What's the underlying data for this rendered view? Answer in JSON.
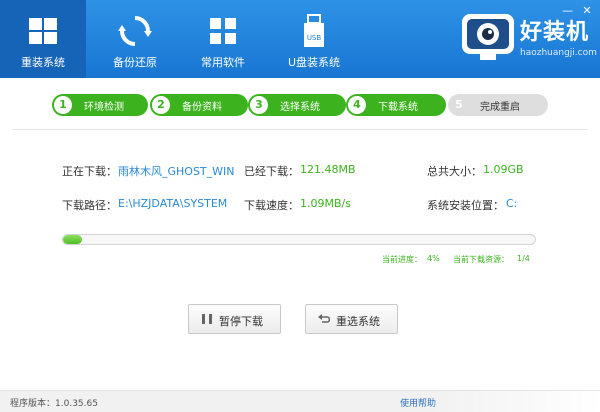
{
  "nav": [
    {
      "label": "重装系统",
      "icon": "windows-icon",
      "active": true
    },
    {
      "label": "备份还原",
      "icon": "restore-icon",
      "active": false
    },
    {
      "label": "常用软件",
      "icon": "apps-grid-icon",
      "active": false
    },
    {
      "label": "U盘装系统",
      "icon": "usb-drive-icon",
      "active": false
    }
  ],
  "usb_text": "USB",
  "brand": {
    "name": "好装机",
    "url": "haozhuangji.com"
  },
  "window": {
    "min": "—",
    "close": "✕"
  },
  "steps": [
    {
      "num": "1",
      "label": "环境检测",
      "done": true
    },
    {
      "num": "2",
      "label": "备份资料",
      "done": true
    },
    {
      "num": "3",
      "label": "选择系统",
      "done": true
    },
    {
      "num": "4",
      "label": "下载系统",
      "done": true
    },
    {
      "num": "5",
      "label": "完成重启",
      "done": false
    }
  ],
  "info": {
    "downloading_label": "正在下载：",
    "downloading_value": "雨林木风_GHOST_WIN",
    "downloaded_label": "已经下载：",
    "downloaded_value": "121.48MB",
    "total_label": "总共大小：",
    "total_value": "1.09GB",
    "path_label": "下载路径：",
    "path_value": "E:\\HZJDATA\\SYSTEM",
    "speed_label": "下载速度：",
    "speed_value": "1.09MB/s",
    "install_pos_label": "系统安装位置：",
    "install_pos_value": "C:"
  },
  "progress": {
    "fraction": 0.04,
    "current_label": "当前进度：",
    "current_value": "4%",
    "resource_label": "当前下载资源：",
    "resource_value": "1/4"
  },
  "buttons": {
    "pause": "暂停下载",
    "reselect": "重选系统"
  },
  "footer": {
    "version_label": "程序版本：",
    "version": "1.0.35.65",
    "help": "使用帮助"
  },
  "colors": {
    "header": "#1f82dc",
    "accent_green": "#3cb31e",
    "link_blue": "#2a8ad8"
  }
}
